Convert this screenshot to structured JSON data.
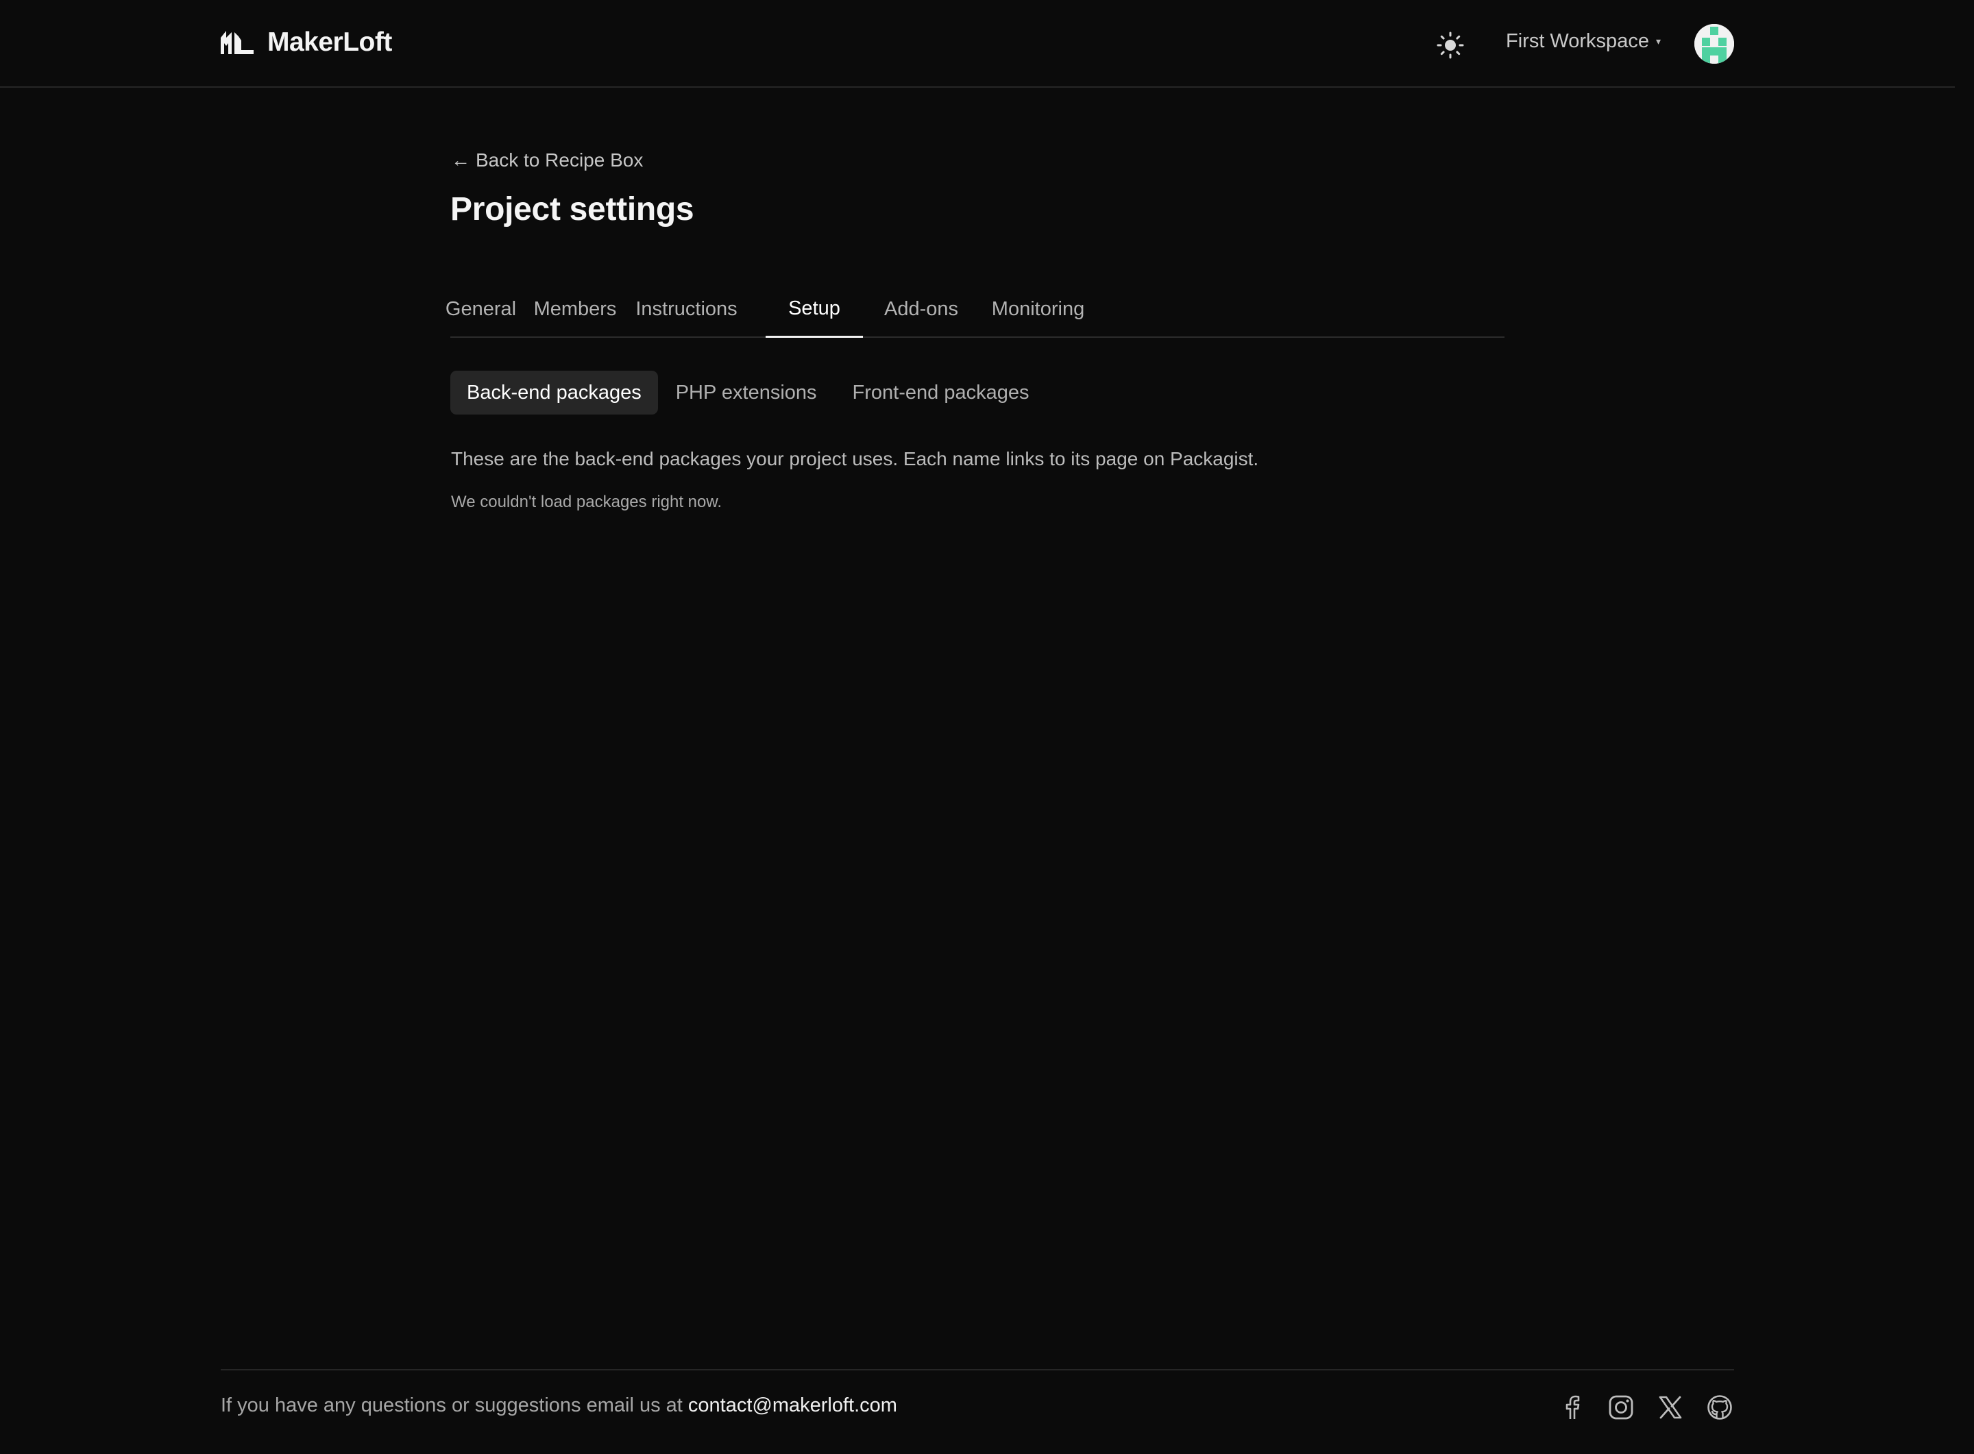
{
  "header": {
    "brand": "MakerLoft",
    "workspace": "First Workspace",
    "workspace_caret": "▾",
    "icons": {
      "logo": "makerloft-logo-icon",
      "theme": "sun-icon",
      "avatar": "user-avatar"
    }
  },
  "back_link": {
    "arrow": "←",
    "label": "Back to Recipe Box"
  },
  "page_title": "Project settings",
  "tabs": [
    {
      "label": "General",
      "active": false
    },
    {
      "label": "Members",
      "active": false
    },
    {
      "label": "Instructions",
      "active": false
    },
    {
      "label": "Setup",
      "active": true
    },
    {
      "label": "Add-ons",
      "active": false
    },
    {
      "label": "Monitoring",
      "active": false
    }
  ],
  "subtabs": [
    {
      "label": "Back-end packages",
      "active": true
    },
    {
      "label": "PHP extensions",
      "active": false
    },
    {
      "label": "Front-end packages",
      "active": false
    }
  ],
  "content": {
    "description": "These are the back-end packages your project uses. Each name links to its page on Packagist.",
    "error": "We couldn't load packages right now."
  },
  "footer": {
    "text": "If you have any questions or suggestions email us at ",
    "email": "contact@makerloft.com",
    "social_icons": [
      "facebook-icon",
      "instagram-icon",
      "x-icon",
      "github-icon"
    ]
  },
  "colors": {
    "background": "#0b0b0b",
    "active_tab": "#ffffff",
    "inactive_tab": "#b3b3b3",
    "avatar_accent": "#4fd1a0"
  }
}
